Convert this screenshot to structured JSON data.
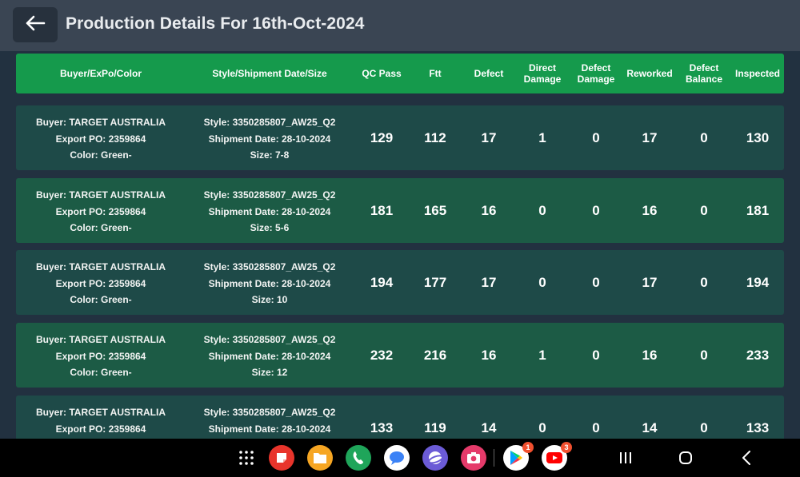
{
  "header": {
    "title": "Production Details For 16th-Oct-2024",
    "back_icon": "arrow-left-icon"
  },
  "table": {
    "columns": [
      {
        "key": "buyer",
        "label": "Buyer/ExPo/Color"
      },
      {
        "key": "style",
        "label": "Style/Shipment Date/Size"
      },
      {
        "key": "qc_pass",
        "label": "QC Pass"
      },
      {
        "key": "ftt",
        "label": "Ftt"
      },
      {
        "key": "defect",
        "label": "Defect"
      },
      {
        "key": "direct_damage",
        "label": "Direct\nDamage"
      },
      {
        "key": "defect_damage",
        "label": "Defect\nDamage"
      },
      {
        "key": "reworked",
        "label": "Reworked"
      },
      {
        "key": "defect_balance",
        "label": "Defect\nBalance"
      },
      {
        "key": "inspected",
        "label": "Inspected"
      }
    ],
    "rows": [
      {
        "buyer": "Buyer: TARGET AUSTRALIA",
        "export_po": "Export PO: 2359864",
        "color": "Color: Green-",
        "style": "Style: 3350285807_AW25_Q2",
        "shipment_date": "Shipment Date: 28-10-2024",
        "size": "Size: 7-8",
        "qc_pass": "129",
        "ftt": "112",
        "defect": "17",
        "direct_damage": "1",
        "defect_damage": "0",
        "reworked": "17",
        "defect_balance": "0",
        "inspected": "130"
      },
      {
        "buyer": "Buyer: TARGET AUSTRALIA",
        "export_po": "Export PO: 2359864",
        "color": "Color: Green-",
        "style": "Style: 3350285807_AW25_Q2",
        "shipment_date": "Shipment Date: 28-10-2024",
        "size": "Size: 5-6",
        "qc_pass": "181",
        "ftt": "165",
        "defect": "16",
        "direct_damage": "0",
        "defect_damage": "0",
        "reworked": "16",
        "defect_balance": "0",
        "inspected": "181"
      },
      {
        "buyer": "Buyer: TARGET AUSTRALIA",
        "export_po": "Export PO: 2359864",
        "color": "Color: Green-",
        "style": "Style: 3350285807_AW25_Q2",
        "shipment_date": "Shipment Date: 28-10-2024",
        "size": "Size: 10",
        "qc_pass": "194",
        "ftt": "177",
        "defect": "17",
        "direct_damage": "0",
        "defect_damage": "0",
        "reworked": "17",
        "defect_balance": "0",
        "inspected": "194"
      },
      {
        "buyer": "Buyer: TARGET AUSTRALIA",
        "export_po": "Export PO: 2359864",
        "color": "Color: Green-",
        "style": "Style: 3350285807_AW25_Q2",
        "shipment_date": "Shipment Date: 28-10-2024",
        "size": "Size: 12",
        "qc_pass": "232",
        "ftt": "216",
        "defect": "16",
        "direct_damage": "1",
        "defect_damage": "0",
        "reworked": "16",
        "defect_balance": "0",
        "inspected": "233"
      },
      {
        "buyer": "Buyer: TARGET AUSTRALIA",
        "export_po": "Export PO: 2359864",
        "color": "",
        "style": "Style: 3350285807_AW25_Q2",
        "shipment_date": "Shipment Date: 28-10-2024",
        "size": "",
        "qc_pass": "133",
        "ftt": "119",
        "defect": "14",
        "direct_damage": "0",
        "defect_damage": "0",
        "reworked": "14",
        "defect_balance": "0",
        "inspected": "133"
      }
    ]
  },
  "navbar": {
    "apps": [
      {
        "name": "app-drawer-icon",
        "badge": ""
      },
      {
        "name": "notes-app-icon",
        "badge": "",
        "color": "#e8342b"
      },
      {
        "name": "files-app-icon",
        "badge": "",
        "color": "#f6a623"
      },
      {
        "name": "phone-app-icon",
        "badge": "",
        "color": "#1fa55a"
      },
      {
        "name": "messages-app-icon",
        "badge": "",
        "color": "#3b82f6"
      },
      {
        "name": "internet-app-icon",
        "badge": "",
        "color": "#6b5bd6"
      },
      {
        "name": "camera-app-icon",
        "badge": "",
        "color": "#e53a6a"
      },
      {
        "name": "play-store-icon",
        "badge": "1"
      },
      {
        "name": "youtube-icon",
        "badge": "3",
        "color": "#ff0000"
      }
    ],
    "system": [
      "recents-icon",
      "home-icon",
      "back-icon"
    ]
  },
  "colors": {
    "header_bg": "#3a4553",
    "table_header_bg": "#159a4c",
    "row_odd_bg": "#1e4a48",
    "row_even_bg": "#1c5b45",
    "page_bg": "#223140"
  }
}
